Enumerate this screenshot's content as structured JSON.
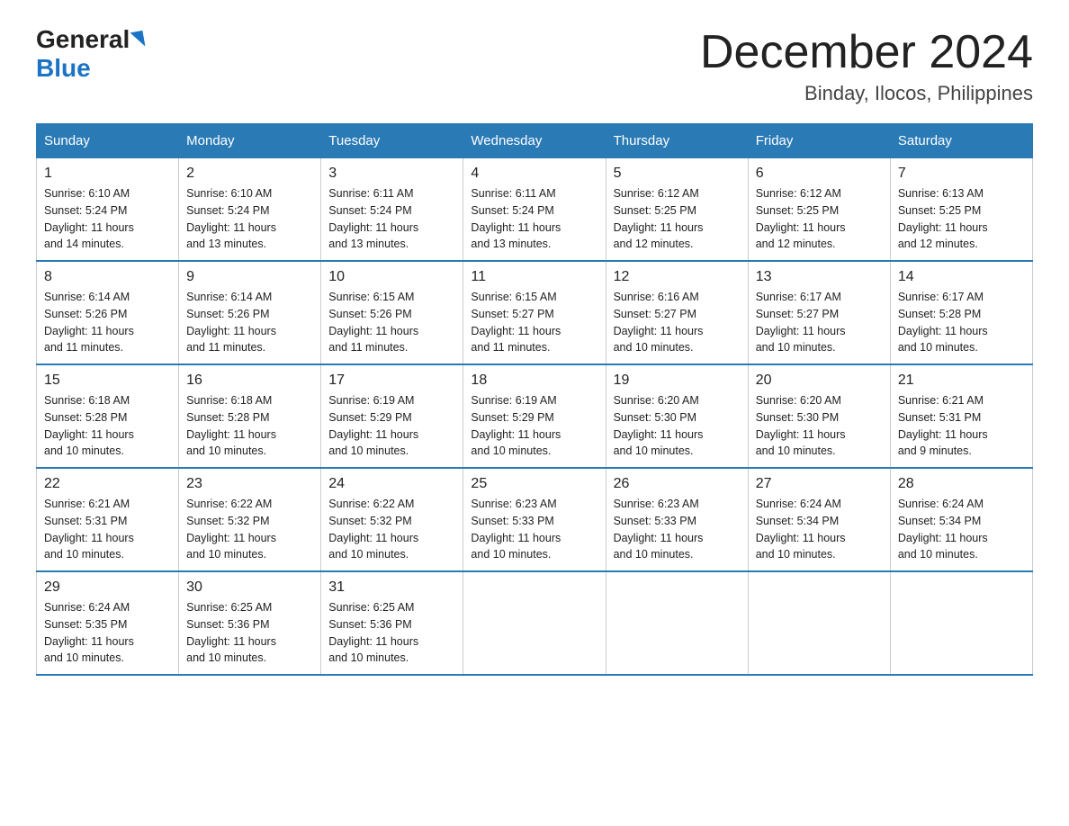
{
  "logo": {
    "name": "General",
    "name2": "Blue"
  },
  "header": {
    "month": "December 2024",
    "location": "Binday, Ilocos, Philippines"
  },
  "days_of_week": [
    "Sunday",
    "Monday",
    "Tuesday",
    "Wednesday",
    "Thursday",
    "Friday",
    "Saturday"
  ],
  "weeks": [
    [
      {
        "day": "1",
        "info": "Sunrise: 6:10 AM\nSunset: 5:24 PM\nDaylight: 11 hours\nand 14 minutes."
      },
      {
        "day": "2",
        "info": "Sunrise: 6:10 AM\nSunset: 5:24 PM\nDaylight: 11 hours\nand 13 minutes."
      },
      {
        "day": "3",
        "info": "Sunrise: 6:11 AM\nSunset: 5:24 PM\nDaylight: 11 hours\nand 13 minutes."
      },
      {
        "day": "4",
        "info": "Sunrise: 6:11 AM\nSunset: 5:24 PM\nDaylight: 11 hours\nand 13 minutes."
      },
      {
        "day": "5",
        "info": "Sunrise: 6:12 AM\nSunset: 5:25 PM\nDaylight: 11 hours\nand 12 minutes."
      },
      {
        "day": "6",
        "info": "Sunrise: 6:12 AM\nSunset: 5:25 PM\nDaylight: 11 hours\nand 12 minutes."
      },
      {
        "day": "7",
        "info": "Sunrise: 6:13 AM\nSunset: 5:25 PM\nDaylight: 11 hours\nand 12 minutes."
      }
    ],
    [
      {
        "day": "8",
        "info": "Sunrise: 6:14 AM\nSunset: 5:26 PM\nDaylight: 11 hours\nand 11 minutes."
      },
      {
        "day": "9",
        "info": "Sunrise: 6:14 AM\nSunset: 5:26 PM\nDaylight: 11 hours\nand 11 minutes."
      },
      {
        "day": "10",
        "info": "Sunrise: 6:15 AM\nSunset: 5:26 PM\nDaylight: 11 hours\nand 11 minutes."
      },
      {
        "day": "11",
        "info": "Sunrise: 6:15 AM\nSunset: 5:27 PM\nDaylight: 11 hours\nand 11 minutes."
      },
      {
        "day": "12",
        "info": "Sunrise: 6:16 AM\nSunset: 5:27 PM\nDaylight: 11 hours\nand 10 minutes."
      },
      {
        "day": "13",
        "info": "Sunrise: 6:17 AM\nSunset: 5:27 PM\nDaylight: 11 hours\nand 10 minutes."
      },
      {
        "day": "14",
        "info": "Sunrise: 6:17 AM\nSunset: 5:28 PM\nDaylight: 11 hours\nand 10 minutes."
      }
    ],
    [
      {
        "day": "15",
        "info": "Sunrise: 6:18 AM\nSunset: 5:28 PM\nDaylight: 11 hours\nand 10 minutes."
      },
      {
        "day": "16",
        "info": "Sunrise: 6:18 AM\nSunset: 5:28 PM\nDaylight: 11 hours\nand 10 minutes."
      },
      {
        "day": "17",
        "info": "Sunrise: 6:19 AM\nSunset: 5:29 PM\nDaylight: 11 hours\nand 10 minutes."
      },
      {
        "day": "18",
        "info": "Sunrise: 6:19 AM\nSunset: 5:29 PM\nDaylight: 11 hours\nand 10 minutes."
      },
      {
        "day": "19",
        "info": "Sunrise: 6:20 AM\nSunset: 5:30 PM\nDaylight: 11 hours\nand 10 minutes."
      },
      {
        "day": "20",
        "info": "Sunrise: 6:20 AM\nSunset: 5:30 PM\nDaylight: 11 hours\nand 10 minutes."
      },
      {
        "day": "21",
        "info": "Sunrise: 6:21 AM\nSunset: 5:31 PM\nDaylight: 11 hours\nand 9 minutes."
      }
    ],
    [
      {
        "day": "22",
        "info": "Sunrise: 6:21 AM\nSunset: 5:31 PM\nDaylight: 11 hours\nand 10 minutes."
      },
      {
        "day": "23",
        "info": "Sunrise: 6:22 AM\nSunset: 5:32 PM\nDaylight: 11 hours\nand 10 minutes."
      },
      {
        "day": "24",
        "info": "Sunrise: 6:22 AM\nSunset: 5:32 PM\nDaylight: 11 hours\nand 10 minutes."
      },
      {
        "day": "25",
        "info": "Sunrise: 6:23 AM\nSunset: 5:33 PM\nDaylight: 11 hours\nand 10 minutes."
      },
      {
        "day": "26",
        "info": "Sunrise: 6:23 AM\nSunset: 5:33 PM\nDaylight: 11 hours\nand 10 minutes."
      },
      {
        "day": "27",
        "info": "Sunrise: 6:24 AM\nSunset: 5:34 PM\nDaylight: 11 hours\nand 10 minutes."
      },
      {
        "day": "28",
        "info": "Sunrise: 6:24 AM\nSunset: 5:34 PM\nDaylight: 11 hours\nand 10 minutes."
      }
    ],
    [
      {
        "day": "29",
        "info": "Sunrise: 6:24 AM\nSunset: 5:35 PM\nDaylight: 11 hours\nand 10 minutes."
      },
      {
        "day": "30",
        "info": "Sunrise: 6:25 AM\nSunset: 5:36 PM\nDaylight: 11 hours\nand 10 minutes."
      },
      {
        "day": "31",
        "info": "Sunrise: 6:25 AM\nSunset: 5:36 PM\nDaylight: 11 hours\nand 10 minutes."
      },
      null,
      null,
      null,
      null
    ]
  ]
}
